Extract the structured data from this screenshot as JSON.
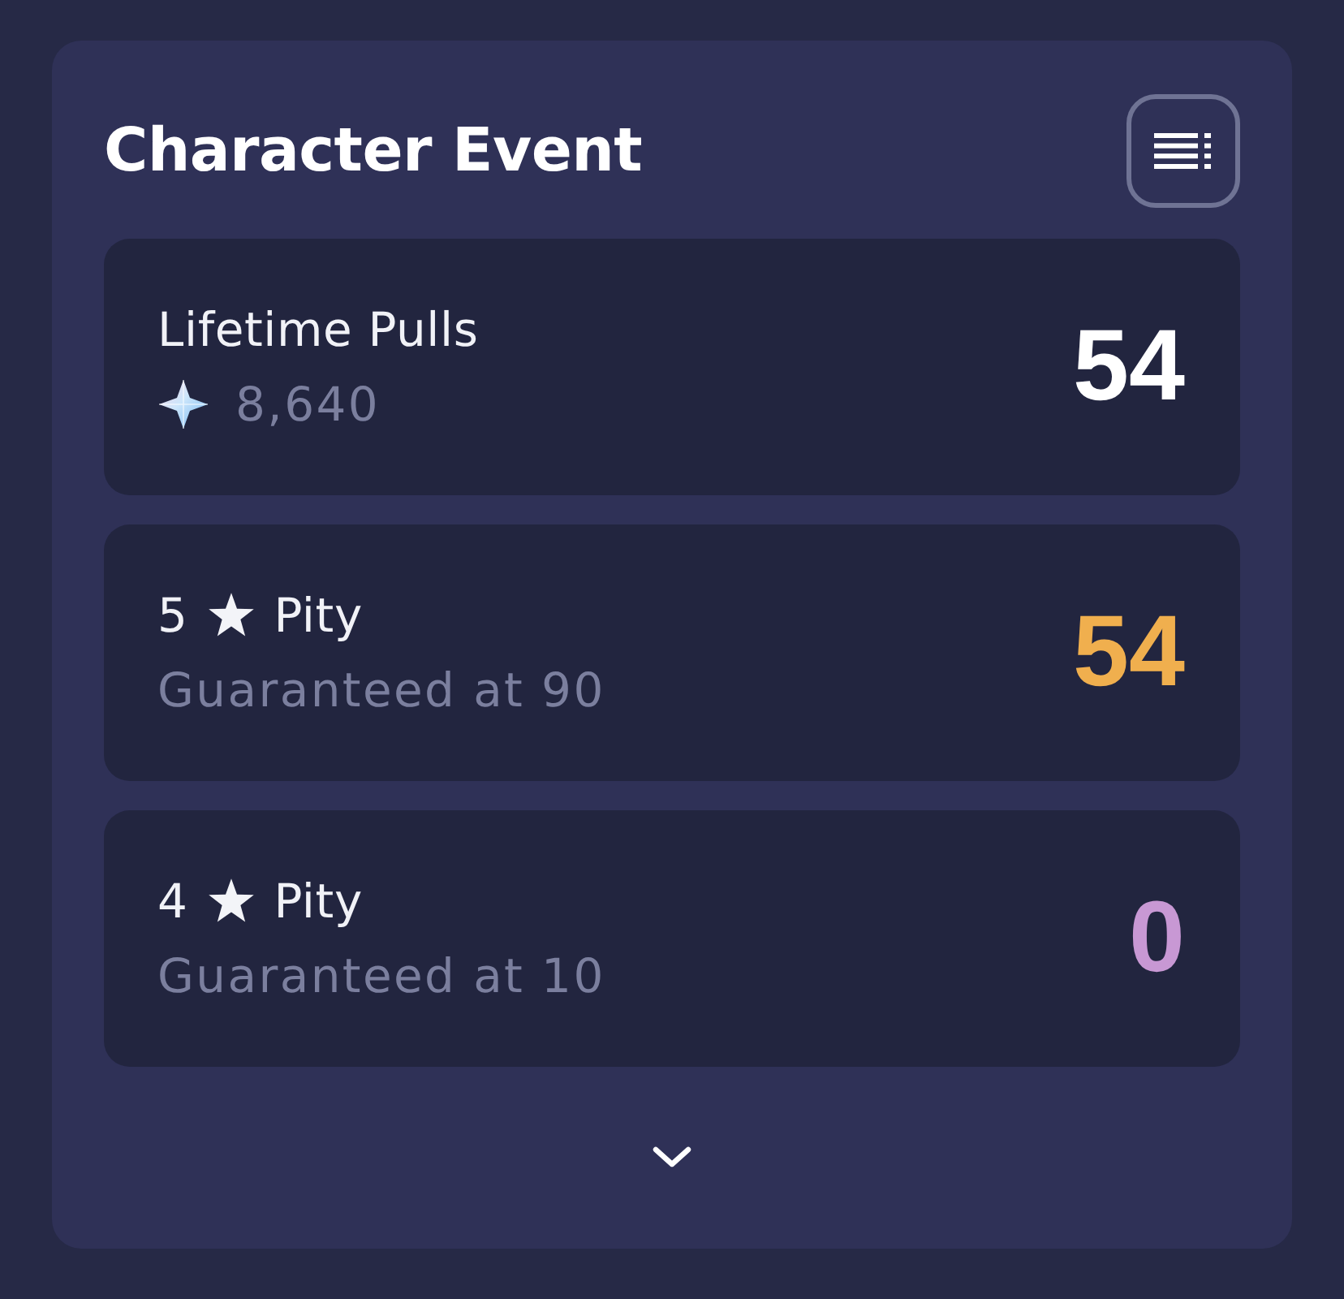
{
  "card": {
    "title": "Character Event"
  },
  "stats": [
    {
      "kind": "total",
      "label": "Lifetime Pulls",
      "amount": "8,640",
      "value": "54",
      "color": "#ffffff"
    },
    {
      "kind": "pity",
      "rarity": "5",
      "label": "Pity",
      "note": "Guaranteed at 90",
      "value": "54",
      "color": "#f0af4e"
    },
    {
      "kind": "pity",
      "rarity": "4",
      "label": "Pity",
      "note": "Guaranteed at 10",
      "value": "0",
      "color": "#c898d4"
    }
  ]
}
